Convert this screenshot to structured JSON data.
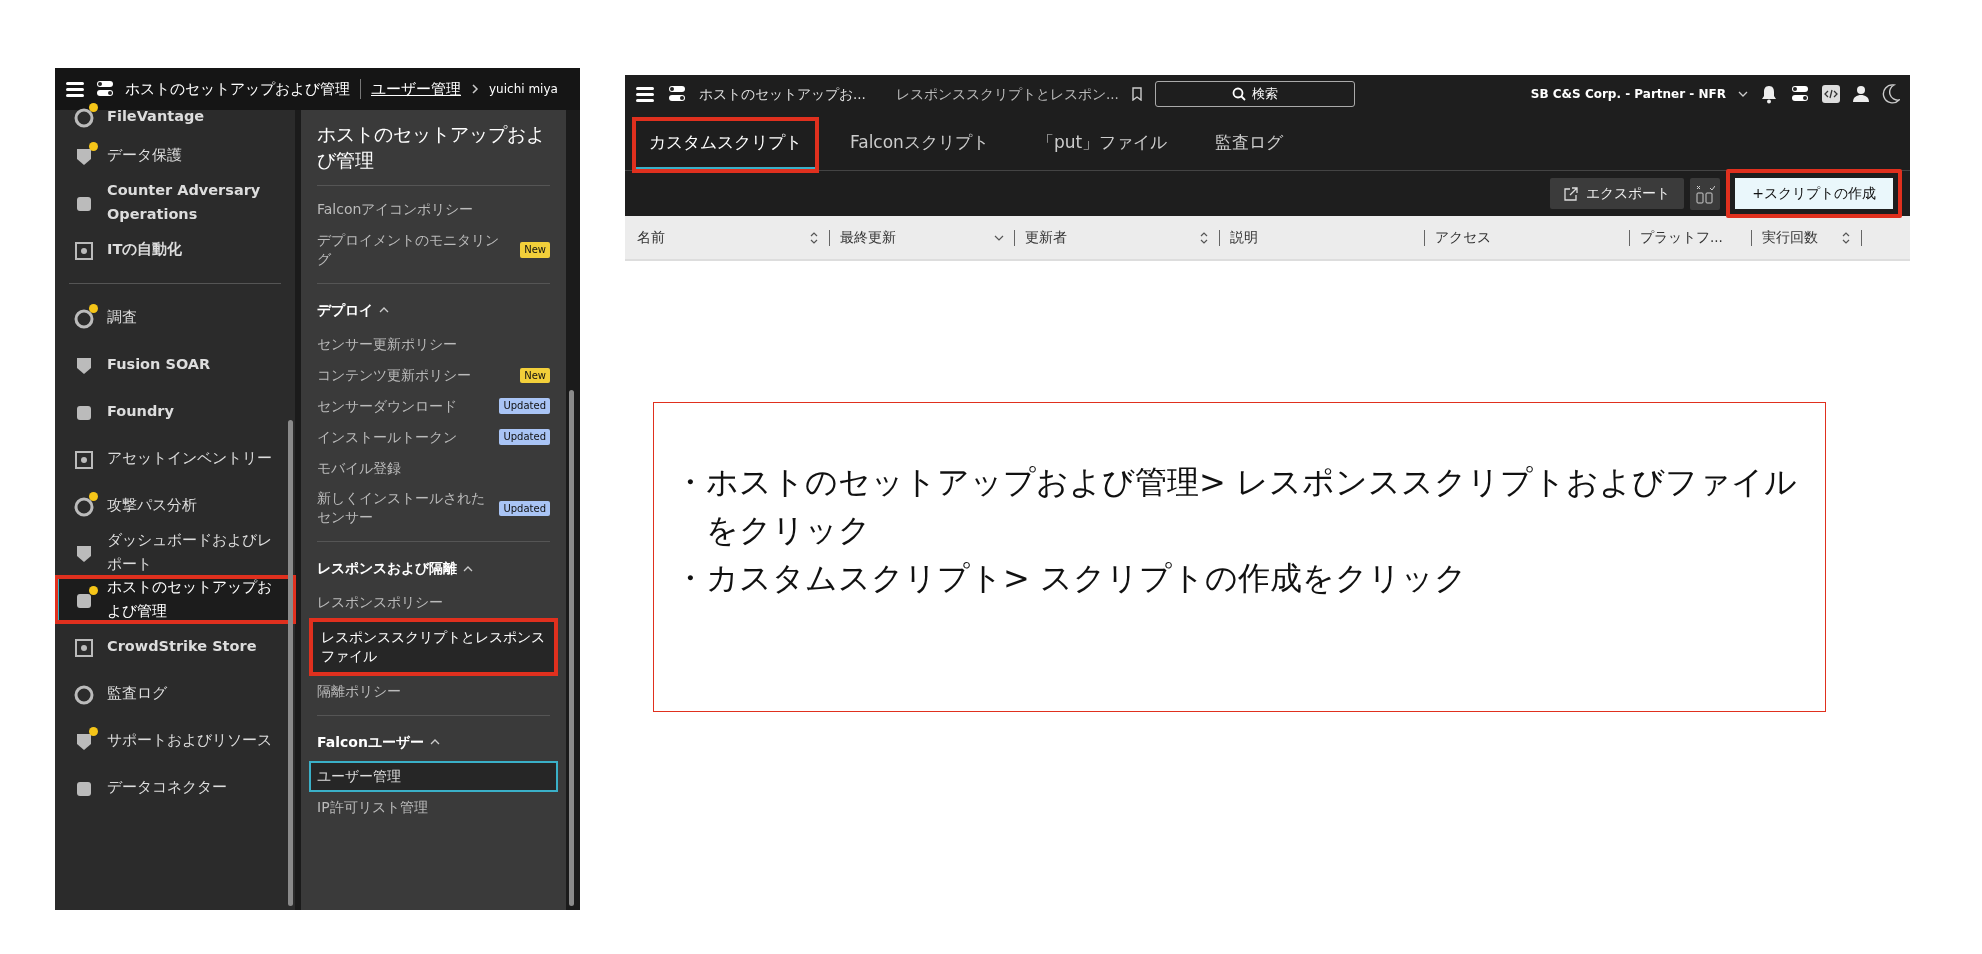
{
  "left_screenshot": {
    "top_bar": {
      "breadcrumb": [
        {
          "label": "ホストのセットアップおよび管理",
          "link": false
        },
        {
          "label": "ユーザー管理",
          "link": true
        },
        {
          "label": "yuichi miya",
          "link": false
        }
      ]
    },
    "nav_groups": [
      [
        {
          "label": "FileVantage",
          "notified": true,
          "highlighted": false
        },
        {
          "label": "データ保護",
          "notified": true,
          "highlighted": false
        },
        {
          "label": "Counter Adversary Operations",
          "notified": false,
          "highlighted": false
        },
        {
          "label": "ITの自動化",
          "notified": false,
          "highlighted": false
        }
      ],
      [
        {
          "label": "調査",
          "notified": true,
          "highlighted": false
        },
        {
          "label": "Fusion SOAR",
          "notified": false,
          "highlighted": false
        },
        {
          "label": "Foundry",
          "notified": false,
          "highlighted": false
        },
        {
          "label": "アセットインベントリー",
          "notified": false,
          "highlighted": false
        },
        {
          "label": "攻撃パス分析",
          "notified": true,
          "highlighted": false
        },
        {
          "label": "ダッシュボードおよびレポート",
          "notified": false,
          "highlighted": false
        },
        {
          "label": "ホストのセットアップおよび管理",
          "notified": true,
          "highlighted": true
        },
        {
          "label": "CrowdStrike Store",
          "notified": false,
          "highlighted": false
        },
        {
          "label": "監査ログ",
          "notified": false,
          "highlighted": false
        },
        {
          "label": "サポートおよびリソース",
          "notified": true,
          "highlighted": false
        },
        {
          "label": "データコネクター",
          "notified": false,
          "highlighted": false
        }
      ]
    ],
    "submenu": {
      "title": "ホストのセットアップおよび管理",
      "sections": [
        {
          "items": [
            {
              "label": "Falconアイコンポリシー",
              "selected": false,
              "highlighted": false
            },
            {
              "label": "デプロイメントのモニタリング",
              "selected": false,
              "highlighted": false,
              "badge": {
                "text": "New",
                "color": "#f2cf3a"
              }
            }
          ]
        },
        {
          "heading": "デプロイ",
          "expanded": true,
          "items": [
            {
              "label": "センサー更新ポリシー",
              "selected": false,
              "highlighted": false
            },
            {
              "label": "コンテンツ更新ポリシー",
              "selected": false,
              "highlighted": false,
              "badge": {
                "text": "New",
                "color": "#f2cf3a"
              }
            },
            {
              "label": "センサーダウンロード",
              "selected": false,
              "highlighted": false,
              "badge": {
                "text": "Updated",
                "color": "#a9c4f5"
              }
            },
            {
              "label": "インストールトークン",
              "selected": false,
              "highlighted": false,
              "badge": {
                "text": "Updated",
                "color": "#a9c4f5"
              }
            },
            {
              "label": "モバイル登録",
              "selected": false,
              "highlighted": false
            },
            {
              "label": "新しくインストールされたセンサー",
              "selected": false,
              "highlighted": false,
              "badge": {
                "text": "Updated",
                "color": "#a9c4f5"
              }
            }
          ]
        },
        {
          "heading": "レスポンスおよび隔離",
          "expanded": true,
          "items": [
            {
              "label": "レスポンスポリシー",
              "selected": false,
              "highlighted": false
            },
            {
              "label": "レスポンススクリプトとレスポンスファイル",
              "selected": false,
              "highlighted": true
            },
            {
              "label": "隔離ポリシー",
              "selected": false,
              "highlighted": false
            }
          ]
        },
        {
          "heading": "Falconユーザー",
          "expanded": true,
          "items": [
            {
              "label": "ユーザー管理",
              "selected": true,
              "highlighted": false
            },
            {
              "label": "IP許可リスト管理",
              "selected": false,
              "highlighted": false
            }
          ]
        }
      ]
    }
  },
  "right_screenshot": {
    "top_bar": {
      "breadcrumb": [
        "ホストのセットアップお...",
        "レスポンススクリプトとレスポン..."
      ],
      "search": "検索",
      "organization": "SB C&S Corp. - Partner - NFR"
    },
    "tabs": [
      {
        "label": "カスタムスクリプト",
        "selected": true,
        "highlighted": true
      },
      {
        "label": "Falconスクリプト",
        "selected": false,
        "highlighted": false
      },
      {
        "label": "「put」ファイル",
        "selected": false,
        "highlighted": false
      },
      {
        "label": "監査ログ",
        "selected": false,
        "highlighted": false
      }
    ],
    "toolbar": {
      "export": "エクスポート",
      "create": {
        "label": "+スクリプトの作成",
        "highlighted": true
      }
    },
    "columns": [
      {
        "label": "名前",
        "kind": "sortable"
      },
      {
        "label": "最終更新",
        "kind": "sorted"
      },
      {
        "label": "更新者",
        "kind": "sortable"
      },
      {
        "label": "説明",
        "kind": "plain"
      },
      {
        "label": "アクセス",
        "kind": "plain"
      },
      {
        "label": "プラットフ...",
        "kind": "plain"
      },
      {
        "label": "実行回数",
        "kind": "sortable"
      }
    ]
  },
  "instructions": [
    "・ホストのセットアップおよび管理> レスポンススクリプトおよびファイルをクリック",
    "・カスタムスクリプト> スクリプトの作成をクリック"
  ]
}
